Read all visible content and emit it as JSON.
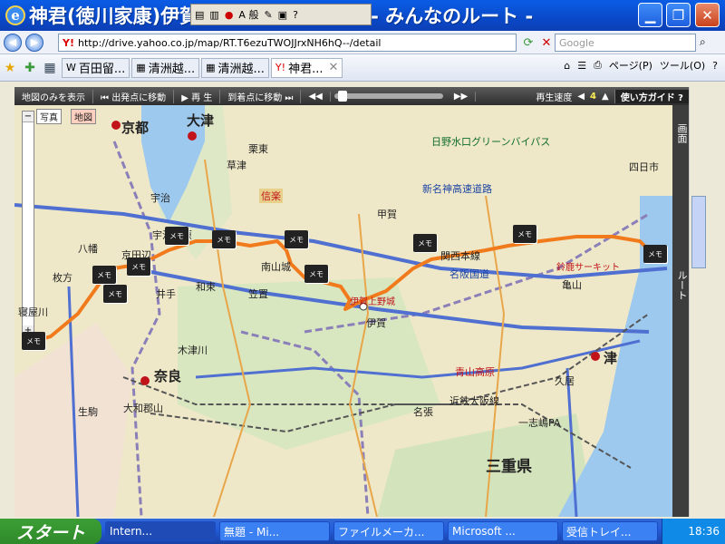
{
  "window": {
    "title": "神君(徳川家康)伊賀越えを辿る・その1 - みんなのルート -",
    "minimize": "▁",
    "maximize": "❐",
    "close": "✕"
  },
  "ime_bar": {
    "mode": "A 般"
  },
  "address": {
    "url": "http://drive.yahoo.co.jp/map/RT.T6ezuTWOJJrxNH6hQ--/detail",
    "search_placeholder": "Google"
  },
  "tabs": [
    {
      "icon": "W",
      "label": "百田留..."
    },
    {
      "icon": "▦",
      "label": "清洲越..."
    },
    {
      "icon": "▦",
      "label": "清洲越..."
    },
    {
      "icon": "Y!",
      "label": "神君..."
    }
  ],
  "toolbar": {
    "page": "ページ(P)",
    "tools": "ツール(O)",
    "help": "?"
  },
  "map_controls": {
    "map_only": "地図のみを表示",
    "to_start": "出発点に移動",
    "play": "再 生",
    "to_end": "到着点に移動",
    "speed_label": "再生速度",
    "speed_value": "4",
    "guide": "使い方ガイド",
    "photo": "写真",
    "map": "地図"
  },
  "side_panel": {
    "top": "画面",
    "bottom": "ルート"
  },
  "map_labels": {
    "kyoto": "京都",
    "otsu": "大津",
    "nara": "奈良",
    "tsu": "津",
    "mie": "三重県",
    "kyotanabe": "京田辺",
    "ide": "井手",
    "wazuka": "和束",
    "shigaraki": "信楽",
    "koka": "甲賀",
    "iga": "伊賀",
    "igaueno": "伊賀上野城",
    "kameyama": "亀山",
    "suzuka": "鈴鹿サーキット",
    "yokkaichi": "四日市",
    "kusatsu": "草津",
    "ritto": "栗東",
    "ujitawara": "宇治田原",
    "hirakata": "枚方",
    "yawata": "八幡",
    "neyagawa": "寝屋川",
    "kizugawa": "木津川",
    "shinmeishin": "新名神高速道路",
    "meihan": "名阪国道",
    "kintetsu": "近鉄大阪線",
    "kansai": "関西本線",
    "nabari": "名張",
    "aoyama": "青山高原",
    "hisai": "久居",
    "ichishi": "一志嶋PA",
    "uji": "宇治",
    "kasagi": "笠置",
    "minamiyamashiro": "南山城",
    "hibiki": "日野水口グリーンバイパス",
    "ikoma": "生駒",
    "ojiya": "大和郡山"
  },
  "memo_label": "メモ",
  "taskbar": {
    "start": "スタート",
    "buttons": [
      "Intern...",
      "無題 - Mi...",
      "ファイルメーカ...",
      "Microsoft ...",
      "受信トレイ..."
    ],
    "clock": "18:36"
  }
}
